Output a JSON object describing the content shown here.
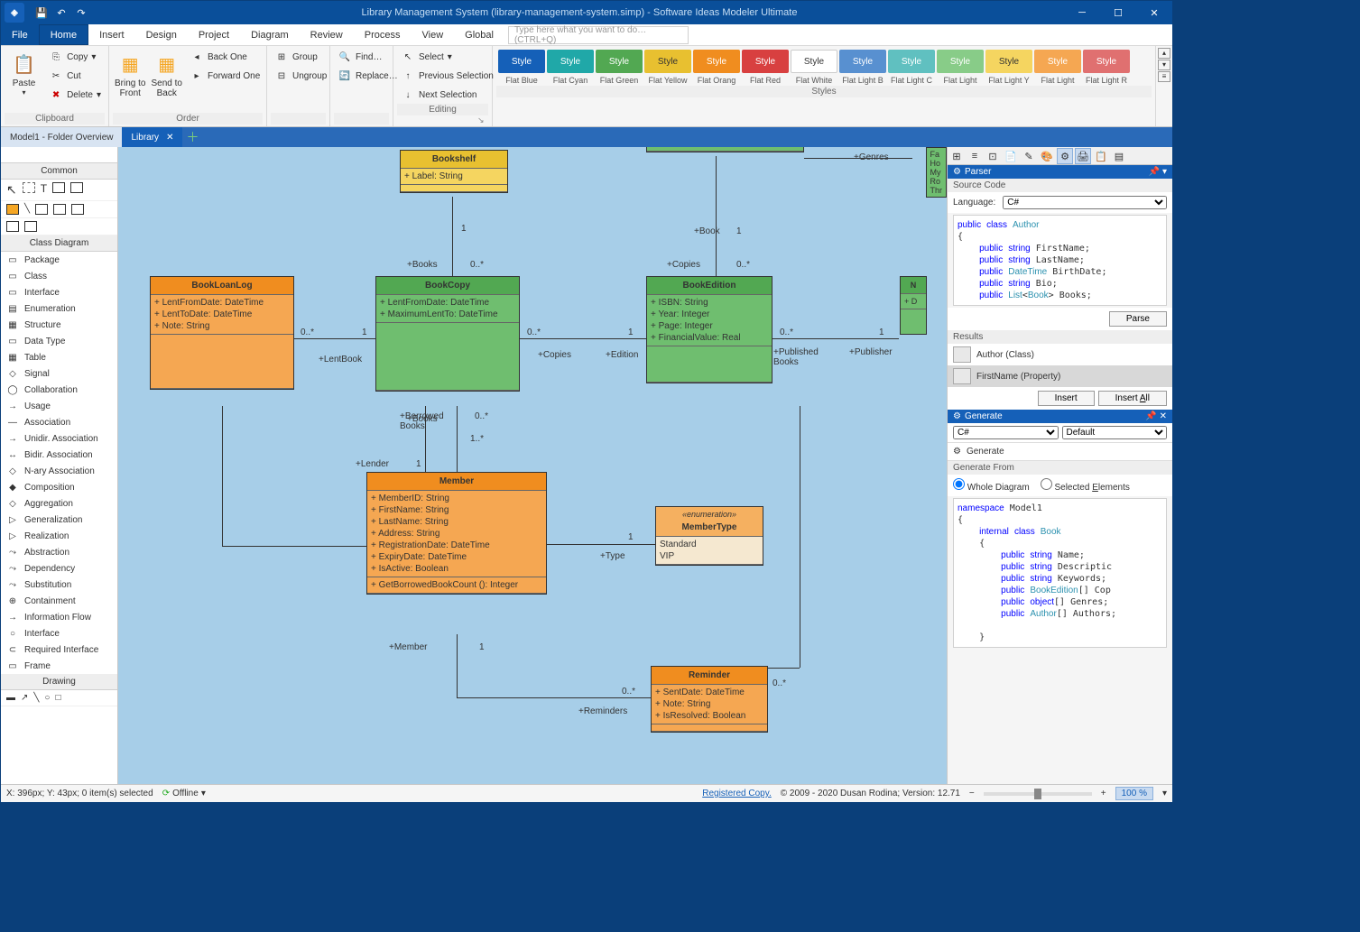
{
  "titlebar": {
    "title": "Library Management System (library-management-system.simp) - Software Ideas Modeler Ultimate"
  },
  "menu": {
    "file": "File",
    "home": "Home",
    "insert": "Insert",
    "design": "Design",
    "project": "Project",
    "diagram": "Diagram",
    "review": "Review",
    "process": "Process",
    "view": "View",
    "global": "Global",
    "search_placeholder": "Type here what you want to do… (CTRL+Q)"
  },
  "ribbon": {
    "clipboard": {
      "label": "Clipboard",
      "paste": "Paste",
      "copy": "Copy",
      "cut": "Cut",
      "delete": "Delete"
    },
    "order": {
      "label": "Order",
      "bring_to_front": "Bring to\nFront",
      "send_to_back": "Send to\nBack",
      "back_one": "Back One",
      "forward_one": "Forward One"
    },
    "group": {
      "group": "Group",
      "ungroup": "Ungroup"
    },
    "find": {
      "find": "Find…",
      "replace": "Replace…"
    },
    "editing": {
      "label": "Editing",
      "select": "Select",
      "previous": "Previous Selection",
      "next": "Next Selection"
    },
    "styles": {
      "label": "Styles",
      "swatches": [
        {
          "name": "Style",
          "suffix": "Flat Blue",
          "bg": "#1560b8",
          "fg": "#fff"
        },
        {
          "name": "Style",
          "suffix": "Flat Cyan",
          "bg": "#20a8a8",
          "fg": "#fff"
        },
        {
          "name": "Style",
          "suffix": "Flat Green",
          "bg": "#52a852",
          "fg": "#fff"
        },
        {
          "name": "Style",
          "suffix": "Flat Yellow",
          "bg": "#e8c030",
          "fg": "#333"
        },
        {
          "name": "Style",
          "suffix": "Flat Orang",
          "bg": "#f08d1f",
          "fg": "#fff"
        },
        {
          "name": "Style",
          "suffix": "Flat Red",
          "bg": "#d84040",
          "fg": "#fff"
        },
        {
          "name": "Style",
          "suffix": "Flat White",
          "bg": "#ffffff",
          "fg": "#333"
        },
        {
          "name": "Style",
          "suffix": "Flat Light B",
          "bg": "#5890d0",
          "fg": "#fff"
        },
        {
          "name": "Style",
          "suffix": "Flat Light C",
          "bg": "#60c0c0",
          "fg": "#fff"
        },
        {
          "name": "Style",
          "suffix": "Flat Light",
          "bg": "#88cc88",
          "fg": "#fff"
        },
        {
          "name": "Style",
          "suffix": "Flat Light Y",
          "bg": "#f5d560",
          "fg": "#333"
        },
        {
          "name": "Style",
          "suffix": "Flat Light",
          "bg": "#f5a752",
          "fg": "#fff"
        },
        {
          "name": "Style",
          "suffix": "Flat Light R",
          "bg": "#e07070",
          "fg": "#fff"
        }
      ]
    }
  },
  "tabs": {
    "t1": "Model1 - Folder Overview",
    "t2": "Library"
  },
  "toolbox": {
    "common": "Common",
    "class_diagram": "Class Diagram",
    "drawing": "Drawing",
    "items": [
      "Package",
      "Class",
      "Interface",
      "Enumeration",
      "Structure",
      "Data Type",
      "Table",
      "Signal",
      "Collaboration",
      "Usage",
      "Association",
      "Unidir. Association",
      "Bidir. Association",
      "N-ary Association",
      "Composition",
      "Aggregation",
      "Generalization",
      "Realization",
      "Abstraction",
      "Dependency",
      "Substitution",
      "Containment",
      "Information Flow",
      "Interface",
      "Required Interface",
      "Frame"
    ]
  },
  "diagram": {
    "bookshelf": {
      "name": "Bookshelf",
      "attrs": [
        "+ Label: String"
      ]
    },
    "bookloan": {
      "name": "BookLoanLog",
      "attrs": [
        "+ LentFromDate: DateTime",
        "+ LentToDate: DateTime",
        "+ Note: String"
      ]
    },
    "bookcopy": {
      "name": "BookCopy",
      "attrs": [
        "+ LentFromDate: DateTime",
        "+ MaximumLentTo: DateTime"
      ]
    },
    "bookedition": {
      "name": "BookEdition",
      "attrs": [
        "+ ISBN: String",
        "+ Year: Integer",
        "+ Page: Integer",
        "+ FinancialValue: Real"
      ]
    },
    "member": {
      "name": "Member",
      "attrs": [
        "+ MemberID: String",
        "+ FirstName: String",
        "+ LastName: String",
        "+ Address: String",
        "+ RegistrationDate: DateTime",
        "+ ExpiryDate: DateTime",
        "+ IsActive: Boolean"
      ],
      "ops": [
        "+ GetBorrowedBookCount (): Integer"
      ]
    },
    "membertype": {
      "name": "MemberType",
      "stereo": "«enumeration»",
      "lits": [
        "Standard",
        "VIP"
      ]
    },
    "reminder": {
      "name": "Reminder",
      "attrs": [
        "+ SentDate: DateTime",
        "+ Note: String",
        "+ IsResolved: Boolean"
      ]
    },
    "labels": {
      "books": "+Books",
      "book": "+Book",
      "copies": "+Copies",
      "lentbook": "+LentBook",
      "edition": "+Edition",
      "publishedbooks": "+Published\nBooks",
      "publisher": "+Publisher",
      "borrowedbooks": "+Borrowed\nBooks",
      "lender": "+Lender",
      "member": "+Member",
      "type": "+Type",
      "reminders": "+Reminders",
      "genres": "+Genres",
      "m_0s": "0..*",
      "m_1s": "1..*",
      "m_1": "1"
    },
    "sidebox": [
      "Fa",
      "Ho",
      "My",
      "Ro",
      "Thr"
    ]
  },
  "parser": {
    "title": "Parser",
    "source_code": "Source Code",
    "language": "Language:",
    "lang_sel": "C#",
    "parse": "Parse",
    "results": "Results",
    "r1": "Author (Class)",
    "r2": "FirstName (Property)",
    "insert": "Insert",
    "insert_all": "Insert All",
    "code": "public class Author\n{\n    public string FirstName;\n    public string LastName;\n    public DateTime BirthDate;\n    public string Bio;\n    public List<Book> Books;"
  },
  "generate": {
    "title": "Generate",
    "lang": "C#",
    "template": "Default",
    "generate": "Generate",
    "from": "Generate From",
    "whole": "Whole Diagram",
    "selected": "Selected Elements",
    "code": "namespace Model1\n{\n    internal class Book\n    {\n        public string Name;\n        public string Descriptic\n        public string Keywords;\n        public BookEdition[] Cop\n        public object[] Genres;\n        public Author[] Authors;\n\n    }"
  },
  "status": {
    "pos": "X: 396px; Y: 43px; 0 item(s) selected",
    "offline": "Offline",
    "registered": "Registered Copy.",
    "copyright": "© 2009 - 2020 Dusan Rodina; Version: 12.71",
    "zoom": "100 %"
  }
}
